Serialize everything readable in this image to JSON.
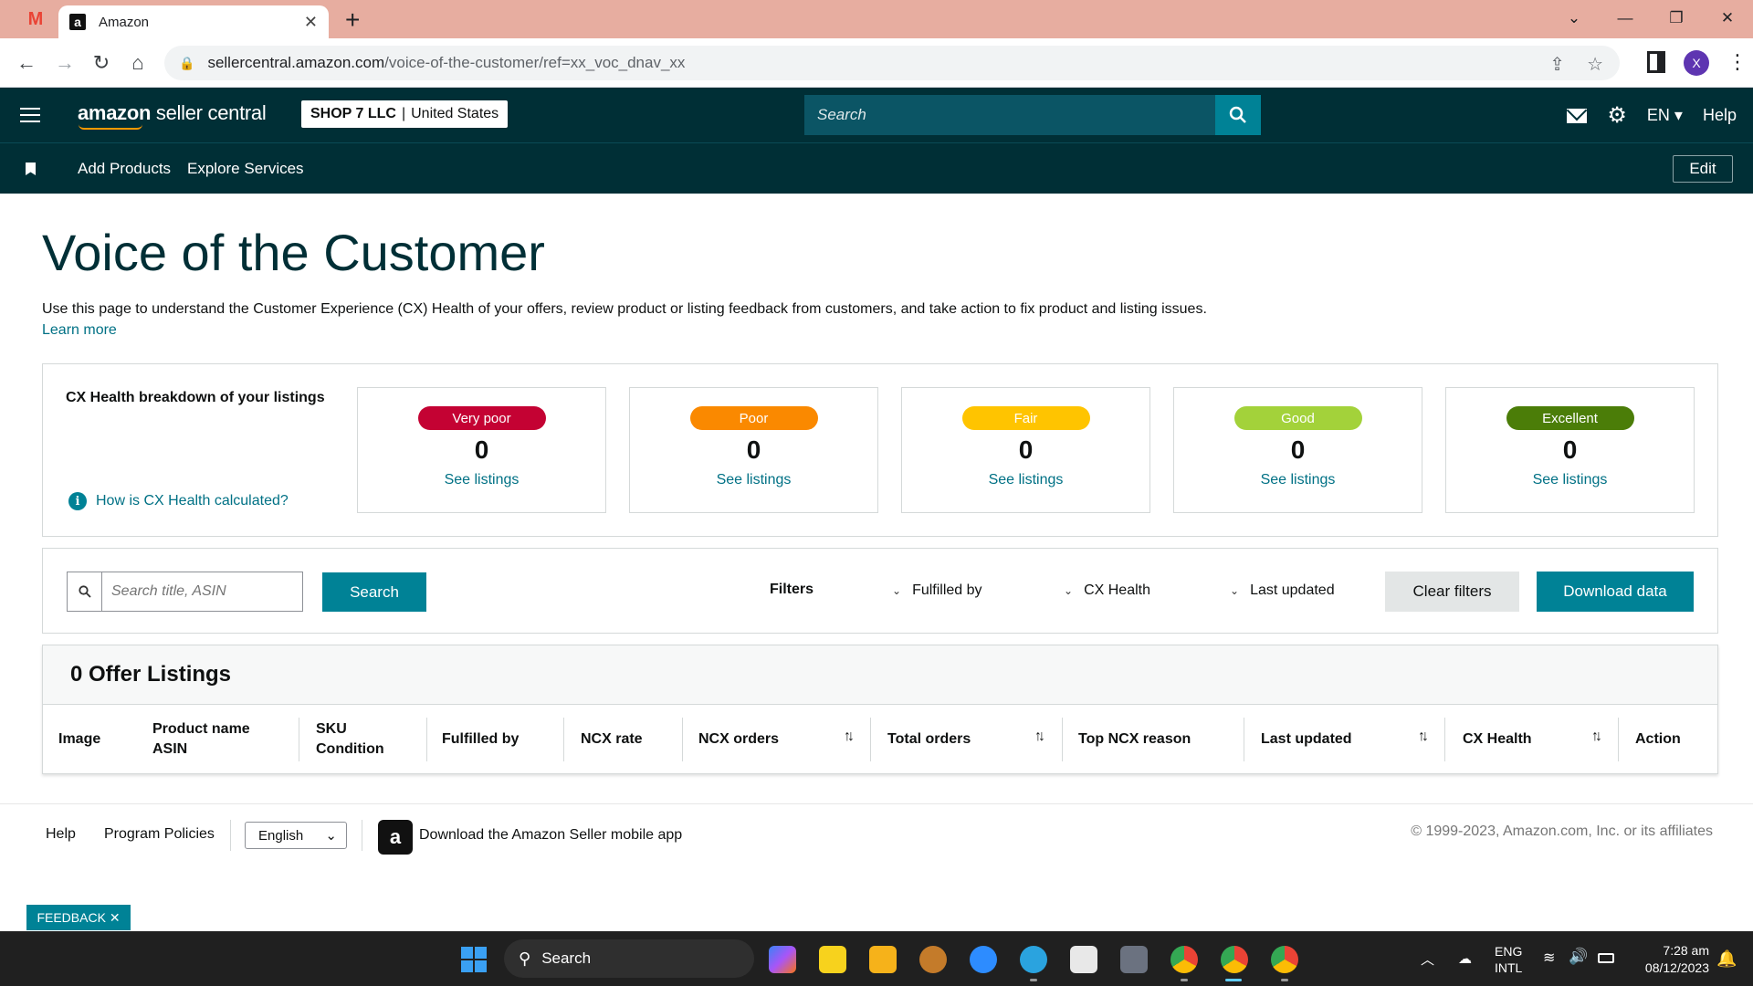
{
  "browser": {
    "tabs": [
      {
        "title": "",
        "icon": "gmail-icon"
      },
      {
        "title": "Amazon",
        "icon": "amazon-icon"
      }
    ],
    "url_domain": "sellercentral.amazon.com",
    "url_path": "/voice-of-the-customer/ref=xx_voc_dnav_xx",
    "profile_initial": "X"
  },
  "header": {
    "logo_main": "amazon",
    "logo_sub": "seller central",
    "shop_name": "SHOP 7 LLC",
    "shop_region": "United States",
    "search_placeholder": "Search",
    "language": "EN",
    "help": "Help"
  },
  "subnav": {
    "links": [
      "Add Products",
      "Explore Services"
    ],
    "edit": "Edit"
  },
  "page": {
    "title": "Voice of the Customer",
    "description": "Use this page to understand the Customer Experience (CX) Health of your offers, review product or listing feedback from customers, and take action to fix product and listing issues.",
    "learn_more": "Learn more"
  },
  "cx_health": {
    "heading": "CX Health breakdown of your listings",
    "how_link": "How is CX Health calculated?",
    "categories": [
      {
        "label": "Very poor",
        "count": "0",
        "link": "See listings",
        "color": "#c40233"
      },
      {
        "label": "Poor",
        "count": "0",
        "link": "See listings",
        "color": "#fa8900"
      },
      {
        "label": "Fair",
        "count": "0",
        "link": "See listings",
        "color": "#ffc400"
      },
      {
        "label": "Good",
        "count": "0",
        "link": "See listings",
        "color": "#a3d23a"
      },
      {
        "label": "Excellent",
        "count": "0",
        "link": "See listings",
        "color": "#4b7d08"
      }
    ]
  },
  "filters": {
    "search_placeholder": "Search title, ASIN",
    "search_button": "Search",
    "label": "Filters",
    "dropdowns": [
      "Fulfilled by",
      "CX Health",
      "Last updated"
    ],
    "clear": "Clear filters",
    "download": "Download data"
  },
  "listings": {
    "title": "0 Offer Listings",
    "columns": {
      "image": "Image",
      "product_name": "Product name",
      "asin": "ASIN",
      "sku": "SKU",
      "condition": "Condition",
      "fulfilled_by": "Fulfilled by",
      "ncx_rate": "NCX rate",
      "ncx_orders": "NCX orders",
      "total_orders": "Total orders",
      "top_ncx_reason": "Top NCX reason",
      "last_updated": "Last updated",
      "cx_health": "CX Health",
      "action": "Action"
    }
  },
  "footer": {
    "help": "Help",
    "program_policies": "Program Policies",
    "language": "English",
    "app_text": "Download the Amazon Seller mobile app",
    "copyright": "© 1999-2023, Amazon.com, Inc. or its affiliates"
  },
  "feedback": "FEEDBACK",
  "taskbar": {
    "search": "Search",
    "lang_line1": "ENG",
    "lang_line2": "INTL",
    "time": "7:28 am",
    "date": "08/12/2023"
  }
}
